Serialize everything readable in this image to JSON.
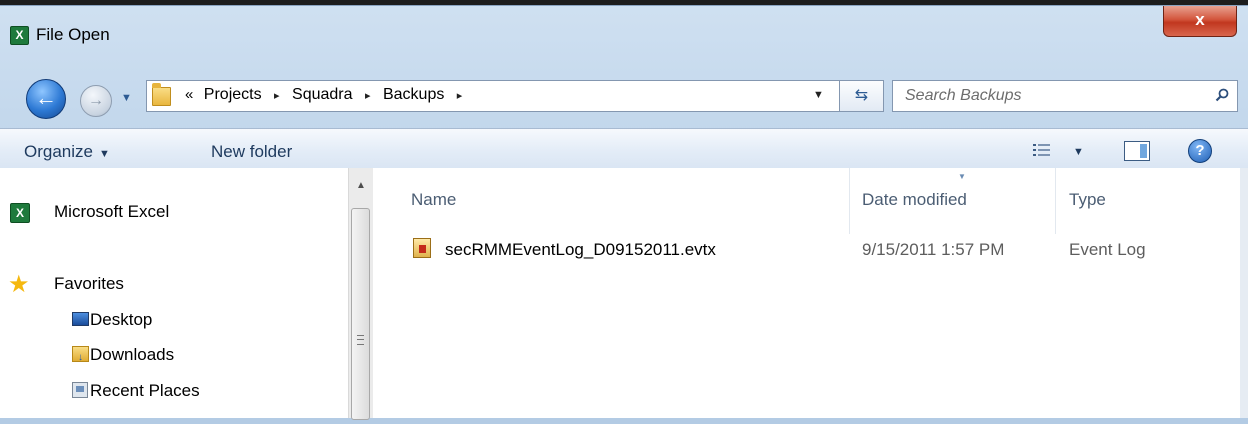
{
  "window": {
    "title": "File Open",
    "app_icon": "excel-icon",
    "close_label": "x"
  },
  "address": {
    "overflow": "«",
    "crumbs": [
      "Projects",
      "Squadra",
      "Backups"
    ],
    "separator": "▸"
  },
  "search": {
    "placeholder": "Search Backups"
  },
  "toolbar": {
    "organize_label": "Organize",
    "new_folder_label": "New folder",
    "help_label": "?"
  },
  "nav_pane": {
    "items": [
      {
        "label": "Microsoft Excel",
        "icon": "excel-icon"
      },
      {
        "label": "Favorites",
        "icon": "star-icon"
      },
      {
        "label": "Desktop",
        "icon": "desktop-icon"
      },
      {
        "label": "Downloads",
        "icon": "downloads-folder-icon"
      },
      {
        "label": "Recent Places",
        "icon": "recent-places-icon"
      }
    ]
  },
  "file_list": {
    "columns": [
      "Name",
      "Date modified",
      "Type"
    ],
    "rows": [
      {
        "name": "secRMMEventLog_D09152011.evtx",
        "date": "9/15/2011 1:57 PM",
        "type": "Event Log",
        "icon": "event-log-icon"
      }
    ]
  },
  "colors": {
    "accent": "#2d79d4",
    "close": "#c1371f",
    "toolbar_text": "#1e3a5e"
  }
}
